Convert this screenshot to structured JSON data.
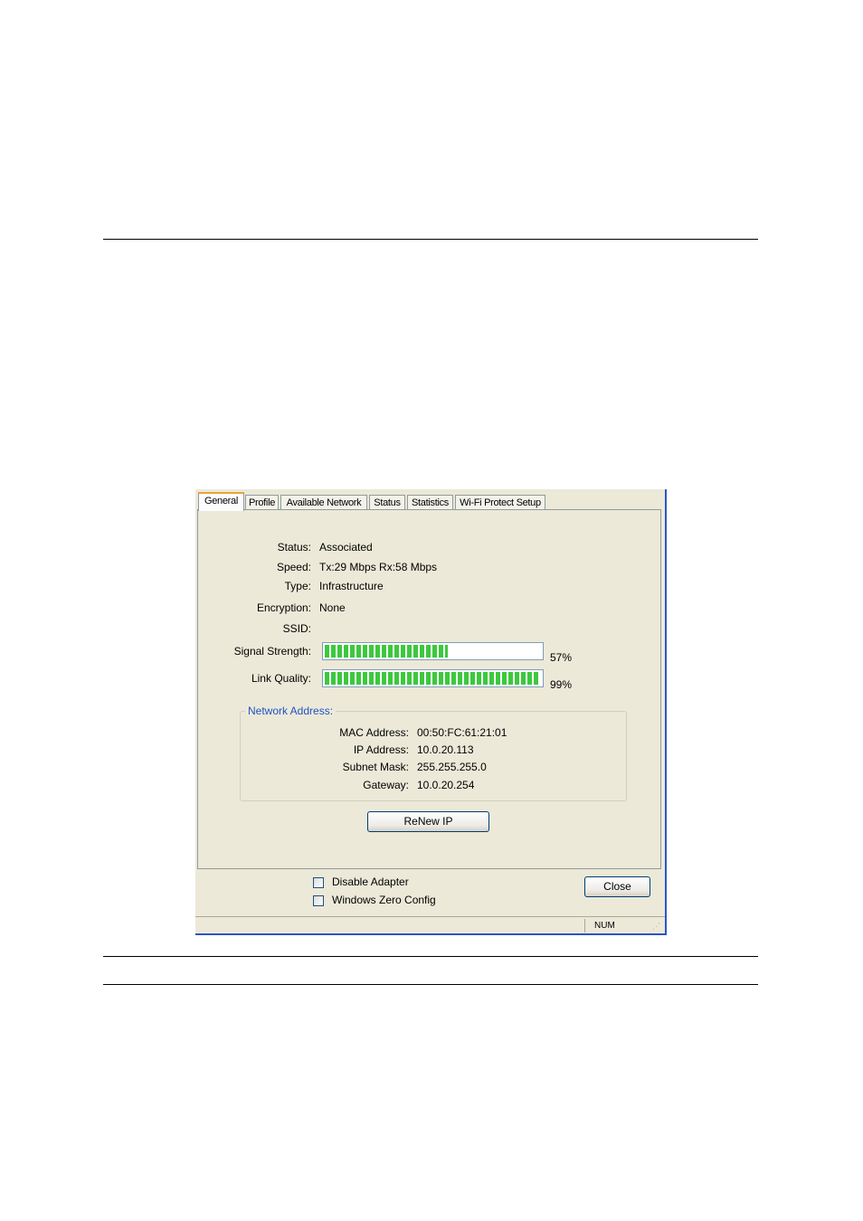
{
  "tabs": [
    "General",
    "Profile",
    "Available Network",
    "Status",
    "Statistics",
    "Wi-Fi Protect Setup"
  ],
  "general": {
    "status_label": "Status:",
    "status_value": "Associated",
    "speed_label": "Speed:",
    "speed_value": "Tx:29 Mbps Rx:58 Mbps",
    "type_label": "Type:",
    "type_value": "Infrastructure",
    "encryption_label": "Encryption:",
    "encryption_value": "None",
    "ssid_label": "SSID:",
    "ssid_value": "",
    "signal_label": "Signal Strength:",
    "signal_percent": 57,
    "signal_text": "57%",
    "link_label": "Link Quality:",
    "link_percent": 99,
    "link_text": "99%"
  },
  "network_address": {
    "title": "Network Address:",
    "mac_label": "MAC Address:",
    "mac_value": "00:50:FC:61:21:01",
    "ip_label": "IP Address:",
    "ip_value": "10.0.20.113",
    "subnet_label": "Subnet Mask:",
    "subnet_value": "255.255.255.0",
    "gateway_label": "Gateway:",
    "gateway_value": "10.0.20.254"
  },
  "buttons": {
    "renew_ip": "ReNew IP",
    "close": "Close"
  },
  "options": {
    "disable_adapter": "Disable Adapter",
    "windows_zero_config": "Windows Zero Config"
  },
  "statusbar": {
    "num": "NUM"
  },
  "colors": {
    "bar_green": "#3dc83d",
    "group_title": "#2152c6",
    "active_tab_accent": "#e8a33d"
  }
}
